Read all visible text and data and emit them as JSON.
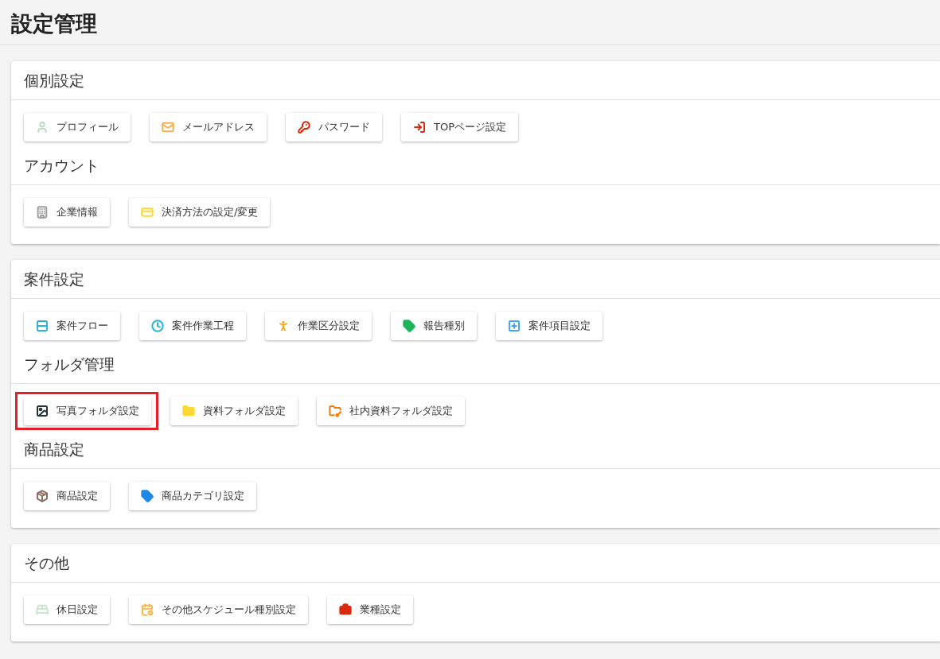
{
  "title": "設定管理",
  "cards": [
    {
      "sections": [
        {
          "title": "個別設定",
          "buttons": [
            {
              "label": "プロフィール",
              "kind": "user",
              "color": "#b9dfc0",
              "highlighted": false
            },
            {
              "label": "メールアドレス",
              "kind": "mail",
              "color": "#f7b04c",
              "highlighted": false
            },
            {
              "label": "パスワード",
              "kind": "key",
              "color": "#d8290f",
              "highlighted": false
            },
            {
              "label": "TOPページ設定",
              "kind": "home",
              "color": "#d8290f",
              "highlighted": false
            }
          ]
        },
        {
          "title": "アカウント",
          "buttons": [
            {
              "label": "企業情報",
              "kind": "building",
              "color": "#9e9e9e",
              "highlighted": false
            },
            {
              "label": "決済方法の設定/変更",
              "kind": "card",
              "color": "#fdd835",
              "highlighted": false
            }
          ]
        }
      ]
    },
    {
      "sections": [
        {
          "title": "案件設定",
          "buttons": [
            {
              "label": "案件フロー",
              "kind": "flow",
              "color": "#29b6d6",
              "highlighted": false
            },
            {
              "label": "案件作業工程",
              "kind": "clock",
              "color": "#29b6d6",
              "highlighted": false
            },
            {
              "label": "作業区分設定",
              "kind": "person",
              "color": "#f4a51c",
              "highlighted": false
            },
            {
              "label": "報告種別",
              "kind": "tag",
              "color": "#1fb45a",
              "highlighted": false
            },
            {
              "label": "案件項目設定",
              "kind": "addbox",
              "color": "#42a5f5",
              "highlighted": false
            }
          ]
        },
        {
          "title": "フォルダ管理",
          "buttons": [
            {
              "label": "写真フォルダ設定",
              "kind": "image",
              "color": "#263238",
              "highlighted": true
            },
            {
              "label": "資料フォルダ設定",
              "kind": "folder",
              "color": "#fdd835",
              "highlighted": false
            },
            {
              "label": "社内資料フォルダ設定",
              "kind": "folderkey",
              "color": "#f57c00",
              "highlighted": false
            }
          ]
        },
        {
          "title": "商品設定",
          "buttons": [
            {
              "label": "商品設定",
              "kind": "package",
              "color": "#8d6e63",
              "highlighted": false
            },
            {
              "label": "商品カテゴリ設定",
              "kind": "tag",
              "color": "#1e88e5",
              "highlighted": false
            }
          ]
        }
      ]
    },
    {
      "sections": [
        {
          "title": "その他",
          "buttons": [
            {
              "label": "休日設定",
              "kind": "bed",
              "color": "#c8e6c9",
              "highlighted": false
            },
            {
              "label": "その他スケジュール種別設定",
              "kind": "calendar",
              "color": "#ffb74d",
              "highlighted": false
            },
            {
              "label": "業種設定",
              "kind": "briefcase",
              "color": "#d8290f",
              "highlighted": false
            }
          ]
        }
      ]
    }
  ]
}
